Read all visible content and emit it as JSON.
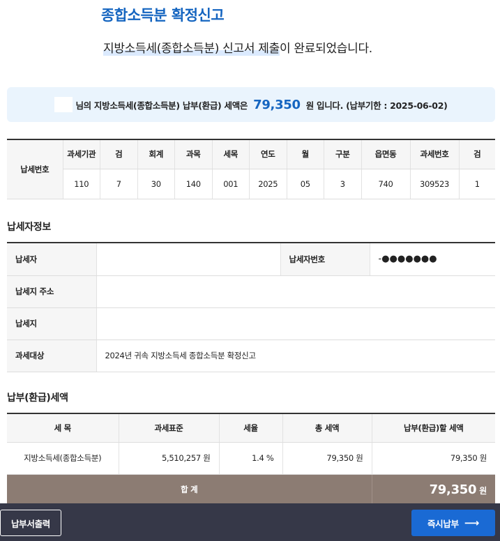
{
  "header": {
    "title": "종합소득분 확정신고",
    "subtitle_main": "지방소득세(종합소득분) 신고서 제출",
    "subtitle_tail": "이 완료되었습니다."
  },
  "summary": {
    "prefix": "님의 지방소득세(종합소득분) 납부(환급) 세액은",
    "amount": "79,350",
    "suffix": "원 입니다. (납부기한 : 2025-06-02)"
  },
  "tax_code": {
    "row_label": "납세번호",
    "headers": [
      "과세기관",
      "검",
      "회계",
      "과목",
      "세목",
      "연도",
      "월",
      "구분",
      "읍면동",
      "과세번호",
      "검"
    ],
    "values": [
      "110",
      "7",
      "30",
      "140",
      "001",
      "2025",
      "05",
      "3",
      "740",
      "309523",
      "1"
    ]
  },
  "taxpayer_info": {
    "section_title": "납세자정보",
    "taxpayer_label": "납세자",
    "taxpayer_value": "",
    "taxpayer_no_label": "납세자번호",
    "taxpayer_no_value": "-●●●●●●●",
    "address_label": "납세지 주소",
    "address_value": "",
    "location_label": "납세지",
    "location_value": "",
    "target_label": "과세대상",
    "target_value": "2024년 귀속 지방소득세 종합소득분 확정신고"
  },
  "tax_amount": {
    "section_title": "납부(환급)세액",
    "headers": [
      "세 목",
      "과세표준",
      "세율",
      "총 세액",
      "납부(환급)할 세액"
    ],
    "row": [
      "지방소득세(종합소득분)",
      "5,510,257 원",
      "1.4 %",
      "79,350 원",
      "79,350 원"
    ],
    "total_label": "합 계",
    "total_value": "79,350",
    "total_unit": "원"
  },
  "actions": {
    "print_label": "납부서출력",
    "pay_label": "즉시납부",
    "pay_icon": "arrow-right-icon"
  },
  "colors": {
    "accent": "#1565c0",
    "summary_bg": "#eaf4fd",
    "total_row_bg": "#8c7c73",
    "bottom_bar_bg": "#363848",
    "pay_button_bg": "#1a6ad4"
  }
}
